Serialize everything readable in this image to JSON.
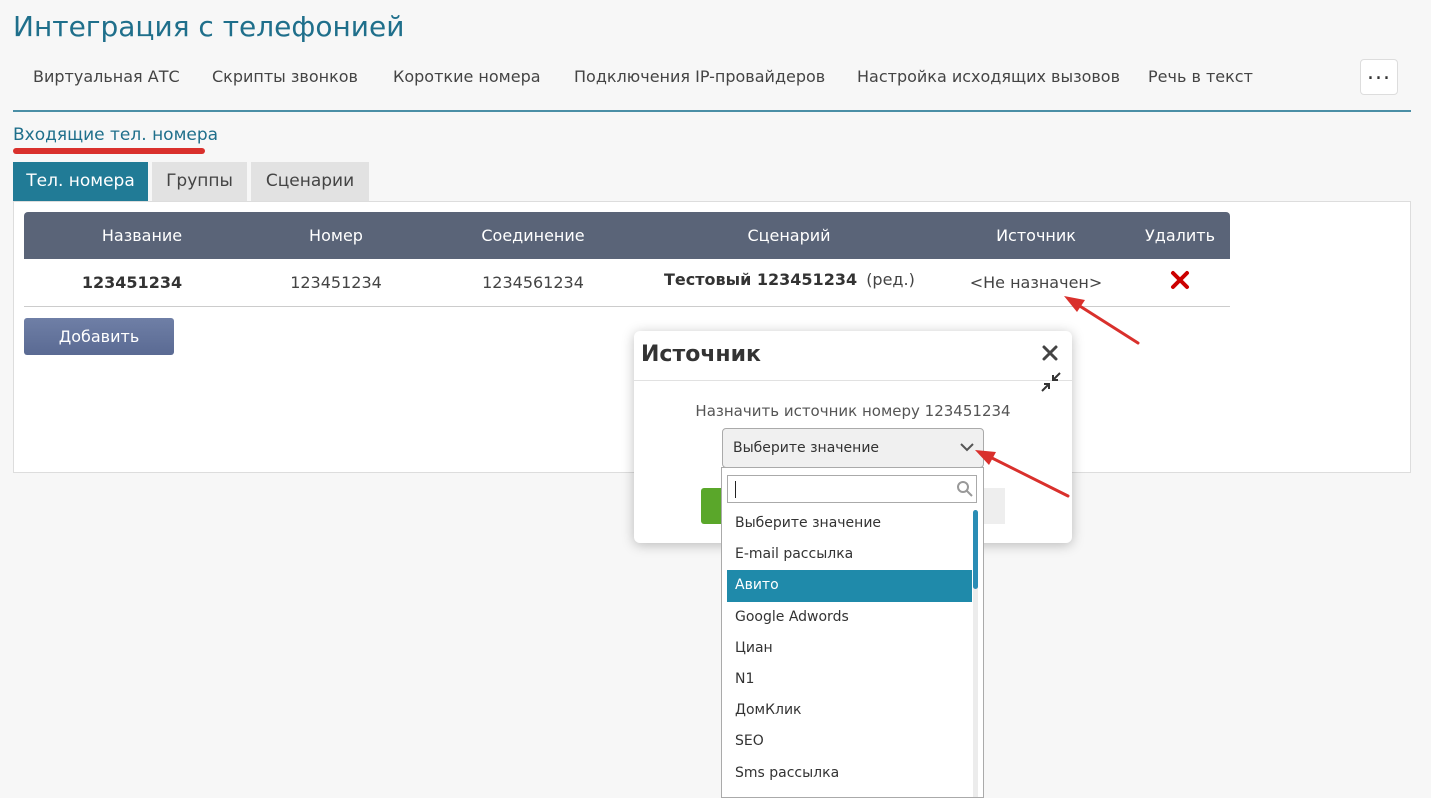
{
  "page": {
    "title": "Интеграция с телефонией"
  },
  "topnav": {
    "items": [
      "Виртуальная АТС",
      "Скрипты звонков",
      "Короткие номера",
      "Подключения IP-провайдеров",
      "Настройка исходящих вызовов",
      "Речь в текст"
    ],
    "more_label": "..."
  },
  "section": {
    "title": "Входящие тел. номера"
  },
  "tabs": [
    {
      "label": "Тел. номера",
      "active": true
    },
    {
      "label": "Группы",
      "active": false
    },
    {
      "label": "Сценарии",
      "active": false
    }
  ],
  "table": {
    "headers": [
      "Название",
      "Номер",
      "Соединение",
      "Сценарий",
      "Источник",
      "Удалить"
    ],
    "rows": [
      {
        "name": "123451234",
        "number": "123451234",
        "connection": "1234561234",
        "scenario": "Тестовый 123451234",
        "scenario_edit": "(ред.)",
        "source": "<Не назначен>"
      }
    ]
  },
  "add_button": {
    "label": "Добавить"
  },
  "dialog": {
    "title": "Источник",
    "message": "Назначить источник номеру 123451234"
  },
  "select": {
    "value": "Выберите значение",
    "search_value": "",
    "options": [
      "Выберите значение",
      "E-mail рассылка",
      "Авито",
      "Google Adwords",
      "Циан",
      "N1",
      "ДомКлик",
      "SEO",
      "Sms рассылка"
    ],
    "highlighted": "Авито"
  },
  "colors": {
    "accent": "#217b96",
    "header": "#5a6478",
    "highlight": "#1f8aaa",
    "annotation": "#d9302c",
    "delete": "#cc0000"
  },
  "icons": {
    "delete": "close-x-icon",
    "dialog_close": "close-icon",
    "dialog_collapse": "collapse-icon",
    "select_arrow": "chevron-down-icon",
    "search": "search-icon"
  }
}
